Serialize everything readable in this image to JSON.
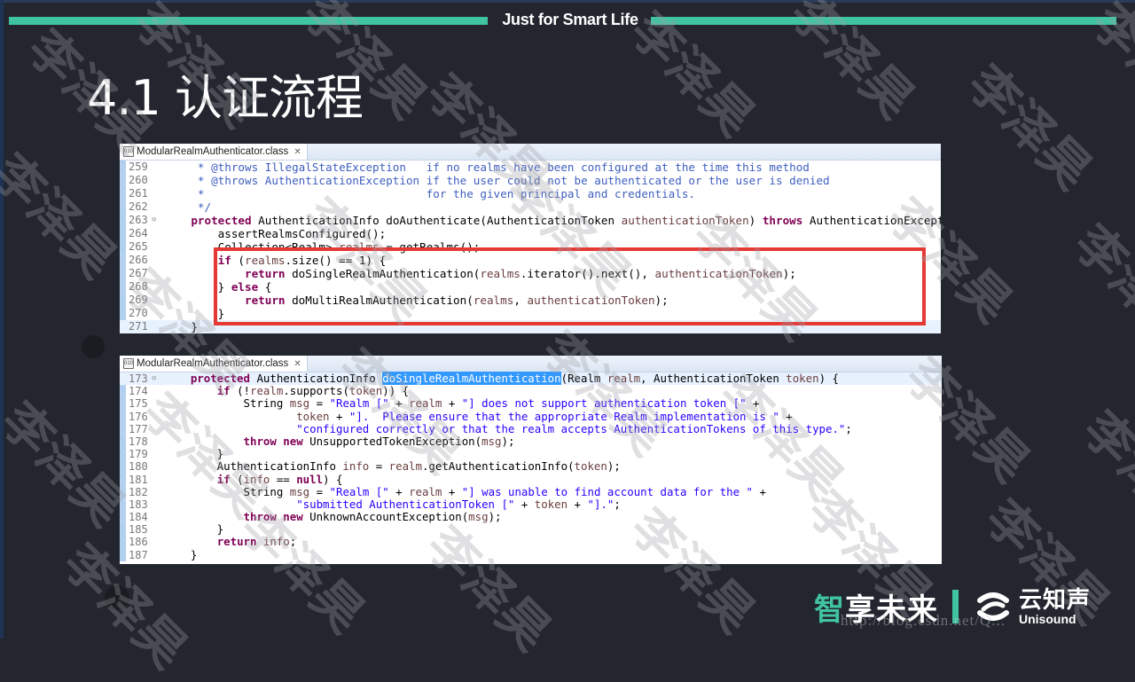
{
  "header": {
    "tagline": "Just for Smart Life",
    "accent_color": "#40c4a0"
  },
  "slide": {
    "title": "4.1 认证流程"
  },
  "watermark_text": "李泽昊",
  "editors": [
    {
      "tab": {
        "icon": "class-file-icon",
        "label": "ModularRealmAuthenticator.class",
        "close_glyph": "✕"
      },
      "lines": [
        {
          "n": "259",
          "html": "     <span class=\"cm\">* @throws IllegalStateException   if no realms have been configured at the time this method</span>"
        },
        {
          "n": "260",
          "html": "     <span class=\"cm\">* @throws AuthenticationException if the user could not be authenticated or the user is denied</span>"
        },
        {
          "n": "261",
          "html": "     <span class=\"cm\">*                                 for the given principal and credentials.</span>"
        },
        {
          "n": "262",
          "html": "     <span class=\"cm\">*/</span>"
        },
        {
          "n": "263",
          "fold": true,
          "html": "    <span class=\"kw\">protected</span> AuthenticationInfo doAuthenticate(AuthenticationToken <span class=\"fld\">authenticationToken</span>) <span class=\"kw\">throws</span> AuthenticationException {"
        },
        {
          "n": "264",
          "html": "        assertRealmsConfigured();"
        },
        {
          "n": "265",
          "html": "        Collection&lt;Realm&gt; <span class=\"fld\">realms</span> = getRealms();"
        },
        {
          "n": "266",
          "html": "        <span class=\"kw\">if</span> (<span class=\"fld\">realms</span>.size() == 1) {"
        },
        {
          "n": "267",
          "html": "            <span class=\"kw\">return</span> doSingleRealmAuthentication(<span class=\"fld\">realms</span>.iterator().next(), <span class=\"fld\">authenticationToken</span>);"
        },
        {
          "n": "268",
          "html": "        } <span class=\"kw\">else</span> {"
        },
        {
          "n": "269",
          "html": "            <span class=\"kw\">return</span> doMultiRealmAuthentication(<span class=\"fld\">realms</span>, <span class=\"fld\">authenticationToken</span>);"
        },
        {
          "n": "270",
          "html": "        }"
        },
        {
          "n": "271",
          "current": true,
          "html": "    }"
        }
      ]
    },
    {
      "tab": {
        "icon": "class-file-icon",
        "label": "ModularRealmAuthenticator.class",
        "close_glyph": "✕"
      },
      "lines": [
        {
          "n": "173",
          "fold": true,
          "current": true,
          "html": "    <span class=\"kw\">protected</span> AuthenticationInfo <span class=\"sel\">doSingleRealmAuthentication</span>(Realm <span class=\"fld\">realm</span>, AuthenticationToken <span class=\"fld\">token</span>) {"
        },
        {
          "n": "174",
          "html": "        <span class=\"kw\">if</span> (!<span class=\"fld\">realm</span>.supports(<span class=\"fld\">token</span>)) {"
        },
        {
          "n": "175",
          "html": "            String <span class=\"fld\">msg</span> = <span class=\"str\">\"Realm [\"</span> + <span class=\"fld\">realm</span> + <span class=\"str\">\"] does not support authentication token [\"</span> +"
        },
        {
          "n": "176",
          "html": "                    <span class=\"fld\">token</span> + <span class=\"str\">\"].  Please ensure that the appropriate Realm implementation is \"</span> +"
        },
        {
          "n": "177",
          "html": "                    <span class=\"str\">\"configured correctly or that the realm accepts AuthenticationTokens of this type.\"</span>;"
        },
        {
          "n": "178",
          "html": "            <span class=\"kw\">throw new</span> UnsupportedTokenException(<span class=\"fld\">msg</span>);"
        },
        {
          "n": "179",
          "html": "        }"
        },
        {
          "n": "180",
          "html": "        AuthenticationInfo <span class=\"fld\">info</span> = <span class=\"fld\">realm</span>.getAuthenticationInfo(<span class=\"fld\">token</span>);"
        },
        {
          "n": "181",
          "html": "        <span class=\"kw\">if</span> (<span class=\"fld\">info</span> == <span class=\"kw\">null</span>) {"
        },
        {
          "n": "182",
          "html": "            String <span class=\"fld\">msg</span> = <span class=\"str\">\"Realm [\"</span> + <span class=\"fld\">realm</span> + <span class=\"str\">\"] was unable to find account data for the \"</span> +"
        },
        {
          "n": "183",
          "html": "                    <span class=\"str\">\"submitted AuthenticationToken [\"</span> + <span class=\"fld\">token</span> + <span class=\"str\">\"].\"</span>;"
        },
        {
          "n": "184",
          "html": "            <span class=\"kw\">throw new</span> UnknownAccountException(<span class=\"fld\">msg</span>);"
        },
        {
          "n": "185",
          "html": "        }"
        },
        {
          "n": "186",
          "html": "        <span class=\"kw\">return</span> <span class=\"fld\">info</span>;"
        },
        {
          "n": "187",
          "html": "    }"
        }
      ]
    }
  ],
  "highlight": {
    "color": "#e53935",
    "editor": 0,
    "lines": [
      "266",
      "270"
    ]
  },
  "footer": {
    "slogan_accent": "智",
    "slogan_rest": "享未来",
    "brand_cn": "云知声",
    "brand_en": "Unisound",
    "url_watermark": "http://blog.csdn.net/Q..."
  }
}
